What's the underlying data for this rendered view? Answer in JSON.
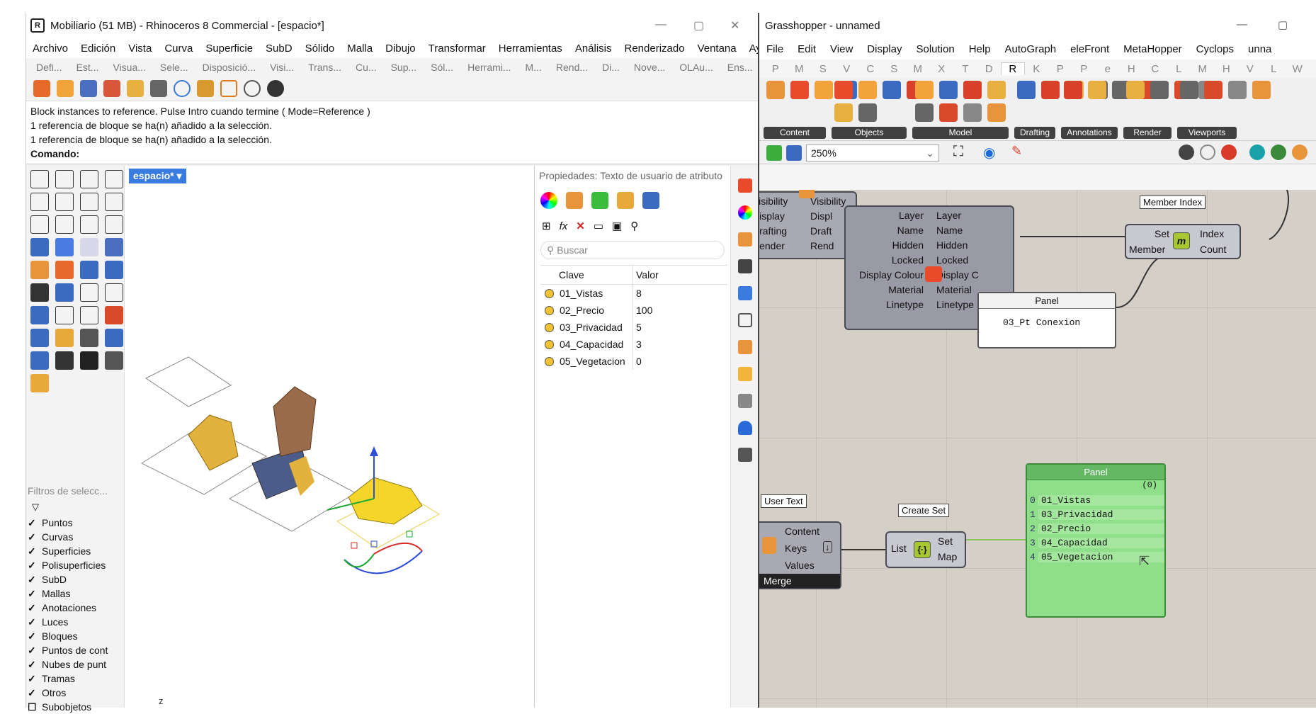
{
  "rhino": {
    "title": "Mobiliario (51 MB) - Rhinoceros 8 Commercial - [espacio*]",
    "menu": [
      "Archivo",
      "Edición",
      "Vista",
      "Curva",
      "Superficie",
      "SubD",
      "Sólido",
      "Malla",
      "Dibujo",
      "Transformar",
      "Herramientas",
      "Análisis",
      "Renderizado",
      "Ventana",
      "Ayuda"
    ],
    "tabs": [
      "Defi...",
      "Est...",
      "Visua...",
      "Sele...",
      "Disposició...",
      "Visi...",
      "Trans...",
      "Cu...",
      "Sup...",
      "Sól...",
      "Herrami...",
      "M...",
      "Rend...",
      "Di...",
      "Nove...",
      "OLAu...",
      "Ens..."
    ],
    "command_lines": [
      "Block instances to reference. Pulse Intro cuando termine ( Mode=Reference )",
      "1 referencia de bloque se ha(n) añadido a la selección.",
      "1 referencia de bloque se ha(n) añadido a la selección."
    ],
    "command_prompt": "Comando:",
    "viewport_tab": "espacio*",
    "axis_label": "z",
    "filters_title": "Filtros de selecc...",
    "filters": [
      {
        "label": "Puntos",
        "checked": true
      },
      {
        "label": "Curvas",
        "checked": true
      },
      {
        "label": "Superficies",
        "checked": true
      },
      {
        "label": "Polisuperficies",
        "checked": true
      },
      {
        "label": "SubD",
        "checked": true
      },
      {
        "label": "Mallas",
        "checked": true
      },
      {
        "label": "Anotaciones",
        "checked": true
      },
      {
        "label": "Luces",
        "checked": true
      },
      {
        "label": "Bloques",
        "checked": true
      },
      {
        "label": "Puntos de cont",
        "checked": true
      },
      {
        "label": "Nubes de punt",
        "checked": true
      },
      {
        "label": "Tramas",
        "checked": true
      },
      {
        "label": "Otros",
        "checked": true
      },
      {
        "label": "Subobjetos",
        "checked": false
      }
    ],
    "properties": {
      "header": "Propiedades: Texto de usuario de atributo",
      "search_placeholder": "Buscar",
      "col_key": "Clave",
      "col_value": "Valor",
      "rows": [
        {
          "key": "01_Vistas",
          "value": "8"
        },
        {
          "key": "02_Precio",
          "value": "100"
        },
        {
          "key": "03_Privacidad",
          "value": "5"
        },
        {
          "key": "04_Capacidad",
          "value": "3"
        },
        {
          "key": "05_Vegetacion",
          "value": "0"
        }
      ]
    }
  },
  "gh": {
    "title": "Grasshopper - unnamed",
    "menu": [
      "File",
      "Edit",
      "View",
      "Display",
      "Solution",
      "Help",
      "AutoGraph",
      "eleFront",
      "MetaHopper",
      "Cyclops",
      "unna"
    ],
    "categories": [
      "P",
      "M",
      "S",
      "V",
      "C",
      "S",
      "M",
      "X",
      "T",
      "D",
      "R",
      "K",
      "P",
      "P",
      "e",
      "H",
      "C",
      "L",
      "M",
      "H",
      "V",
      "L",
      "W"
    ],
    "selected_category": "R",
    "ribbon_groups": [
      "Content",
      "Objects",
      "Model",
      "Drafting",
      "Annotations",
      "Render",
      "Viewports"
    ],
    "zoom": "250%",
    "attr_left": [
      "Visibility",
      "Display",
      "Drafting",
      "Render"
    ],
    "attr_left_out": [
      "Visibility",
      "Displ",
      "Draft",
      "Rend"
    ],
    "attr_inputs": [
      "Layer",
      "Name",
      "Hidden",
      "Locked",
      "Display Colour",
      "Material",
      "Linetype"
    ],
    "attr_outputs": [
      "Layer",
      "Name",
      "Hidden",
      "Locked",
      "Display C",
      "Material",
      "Linetype"
    ],
    "member_index": {
      "title": "Member Index",
      "inputs": [
        "Set",
        "Member"
      ],
      "outputs": [
        "Index",
        "Count"
      ]
    },
    "panel_top": {
      "title": "Panel",
      "text": "03_Pt Conexion"
    },
    "user_text": {
      "title": "User Text",
      "outputs": [
        "Content",
        "Keys",
        "Values"
      ],
      "footer": "Merge"
    },
    "create_set": {
      "title": "Create Set",
      "input": "List",
      "outputs": [
        "Set",
        "Map"
      ]
    },
    "panel_green": {
      "title": "Panel",
      "count": "(0)",
      "items": [
        {
          "i": "0",
          "v": "01_Vistas"
        },
        {
          "i": "1",
          "v": "03_Privacidad"
        },
        {
          "i": "2",
          "v": "02_Precio"
        },
        {
          "i": "3",
          "v": "04_Capacidad"
        },
        {
          "i": "4",
          "v": "05_Vegetacion"
        }
      ]
    }
  }
}
